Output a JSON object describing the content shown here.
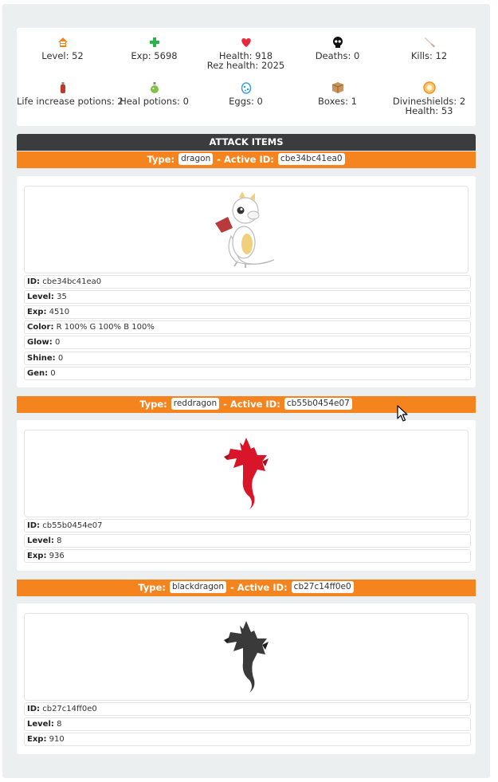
{
  "stats": [
    {
      "icon": "level-icon",
      "lines": [
        "Level: 52"
      ],
      "color": "#f5841f"
    },
    {
      "icon": "exp-icon",
      "lines": [
        "Exp: 5698"
      ],
      "color": "#2bb44a"
    },
    {
      "icon": "heart-icon",
      "lines": [
        "Health: 918",
        "Rez health: 2025"
      ],
      "color": "#e8283c"
    },
    {
      "icon": "skull-icon",
      "lines": [
        "Deaths: 0"
      ],
      "color": "#111111"
    },
    {
      "icon": "sword-icon",
      "lines": [
        "Kills: 12"
      ],
      "color": "#c9a8a0"
    },
    {
      "icon": "life-potion-icon",
      "lines": [
        "Life increase potions: 2"
      ],
      "color": "#c0392b"
    },
    {
      "icon": "heal-potion-icon",
      "lines": [
        "Heal potions: 0"
      ],
      "color": "#7dc242"
    },
    {
      "icon": "egg-icon",
      "lines": [
        "Eggs: 0"
      ],
      "color": "#3aa0e0"
    },
    {
      "icon": "box-icon",
      "lines": [
        "Boxes: 1"
      ],
      "color": "#b5834a"
    },
    {
      "icon": "shield-icon",
      "lines": [
        "Divineshields: 2",
        "Health: 53"
      ],
      "color": "#f5a623"
    }
  ],
  "section_title": "ATTACK ITEMS",
  "items": [
    {
      "type_label": "Type:",
      "type": "dragon",
      "active_label": "- Active ID:",
      "active_id": "cbe34bc41ea0",
      "dragon_color": "#ffffff",
      "rows": [
        {
          "label": "ID:",
          "value": "cbe34bc41ea0"
        },
        {
          "label": "Level:",
          "value": "35"
        },
        {
          "label": "Exp:",
          "value": "4510"
        },
        {
          "label": "Color:",
          "value": "R 100% G 100% B 100%"
        },
        {
          "label": "Glow:",
          "value": "0"
        },
        {
          "label": "Shine:",
          "value": "0"
        },
        {
          "label": "Gen:",
          "value": "0"
        }
      ]
    },
    {
      "type_label": "Type:",
      "type": "reddragon",
      "active_label": "- Active ID:",
      "active_id": "cb55b0454e07",
      "dragon_color": "#d9152a",
      "rows": [
        {
          "label": "ID:",
          "value": "cb55b0454e07"
        },
        {
          "label": "Level:",
          "value": "8"
        },
        {
          "label": "Exp:",
          "value": "936"
        }
      ]
    },
    {
      "type_label": "Type:",
      "type": "blackdragon",
      "active_label": "- Active ID:",
      "active_id": "cb27c14ff0e0",
      "dragon_color": "#3a3a3a",
      "rows": [
        {
          "label": "ID:",
          "value": "cb27c14ff0e0"
        },
        {
          "label": "Level:",
          "value": "8"
        },
        {
          "label": "Exp:",
          "value": "910"
        }
      ]
    }
  ]
}
